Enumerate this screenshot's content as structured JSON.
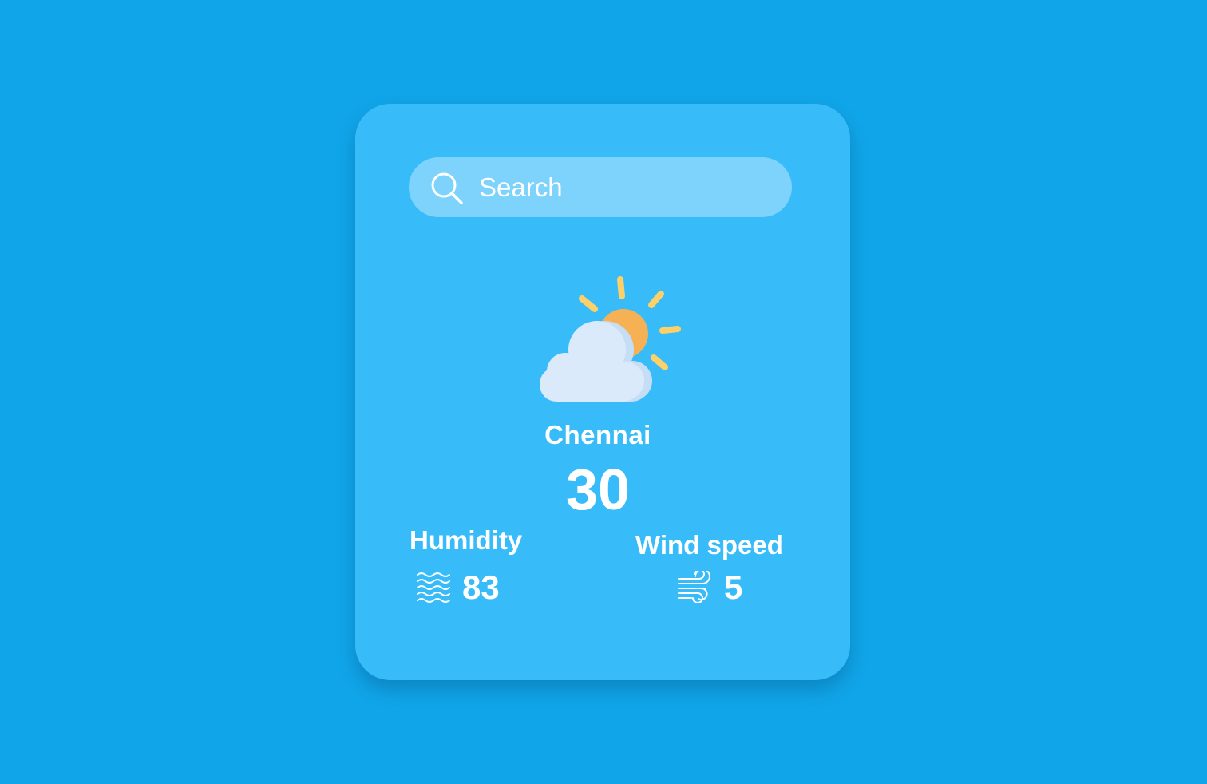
{
  "search": {
    "placeholder": "Search",
    "icon": "search-icon"
  },
  "weather": {
    "icon": "partly-cloudy-icon",
    "city": "Chennai",
    "temperature": "30"
  },
  "humidity": {
    "label": "Humidity",
    "value": "83",
    "icon": "humidity-waves-icon"
  },
  "wind": {
    "label": "Wind speed",
    "value": "5",
    "icon": "wind-icon"
  },
  "colors": {
    "background": "#10a5e8",
    "card": "#38bcf9",
    "sun": "#f5b153",
    "sun_rays": "#fdd168",
    "cloud": "#dbeafb",
    "text": "#ffffff"
  }
}
